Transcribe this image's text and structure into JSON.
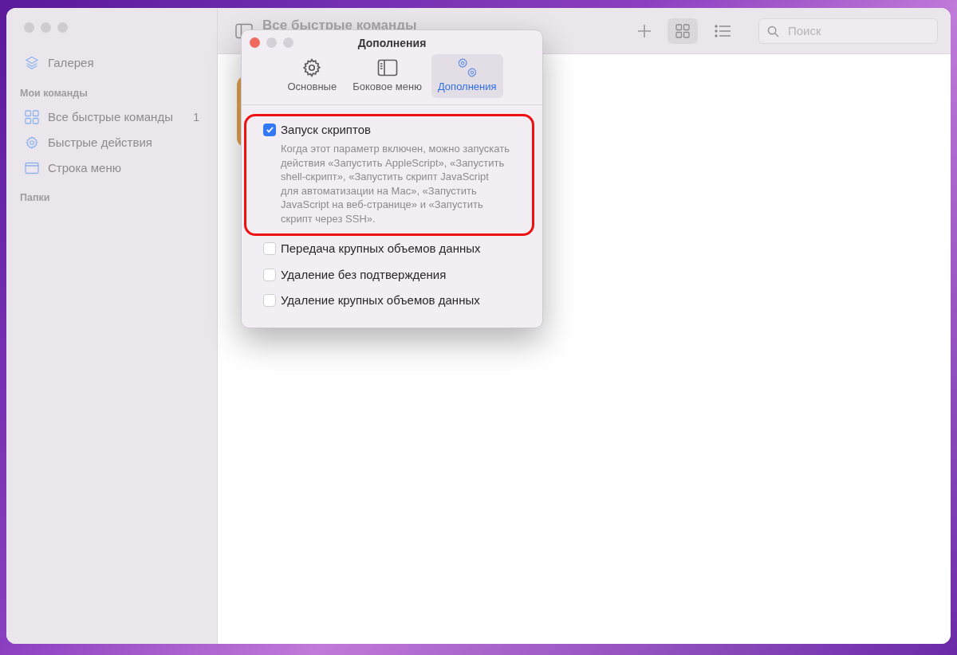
{
  "sidebar": {
    "gallery": "Галерея",
    "sections": [
      {
        "title": "Мои команды",
        "items": [
          {
            "label": "Все быстрые команды",
            "kind": "grid",
            "count": "1"
          },
          {
            "label": "Быстрые действия",
            "kind": "gear"
          },
          {
            "label": "Строка меню",
            "kind": "window"
          }
        ]
      },
      {
        "title": "Папки"
      }
    ]
  },
  "toolbar": {
    "title": "Все быстрые команды",
    "search": {
      "placeholder": "Поиск"
    },
    "views": [
      {
        "kind": "grid",
        "selected": true
      },
      {
        "kind": "list",
        "selected": false
      }
    ]
  },
  "dialog": {
    "title": "Дополнения",
    "tabs": [
      {
        "label": "Основные",
        "kind": "gear",
        "selected": false
      },
      {
        "label": "Боковое меню",
        "kind": "sidebar",
        "selected": false
      },
      {
        "label": "Дополнения",
        "kind": "gears",
        "selected": true
      }
    ],
    "options": [
      {
        "label": "Запуск скриптов",
        "checked": true,
        "highlighted": true,
        "description": "Когда этот параметр включен, можно запускать действия «Запустить AppleScript», «Запустить shell-скрипт», «Запустить скрипт JavaScript\nдля автоматизации на Mac», «Запустить JavaScript на веб-странице» и «Запустить скрипт через SSH»."
      },
      {
        "label": "Передача крупных объемов данных",
        "checked": false,
        "highlighted": false
      },
      {
        "label": "Удаление без подтверждения",
        "checked": false,
        "highlighted": false
      },
      {
        "label": "Удаление крупных объемов данных",
        "checked": false,
        "highlighted": false
      }
    ]
  }
}
